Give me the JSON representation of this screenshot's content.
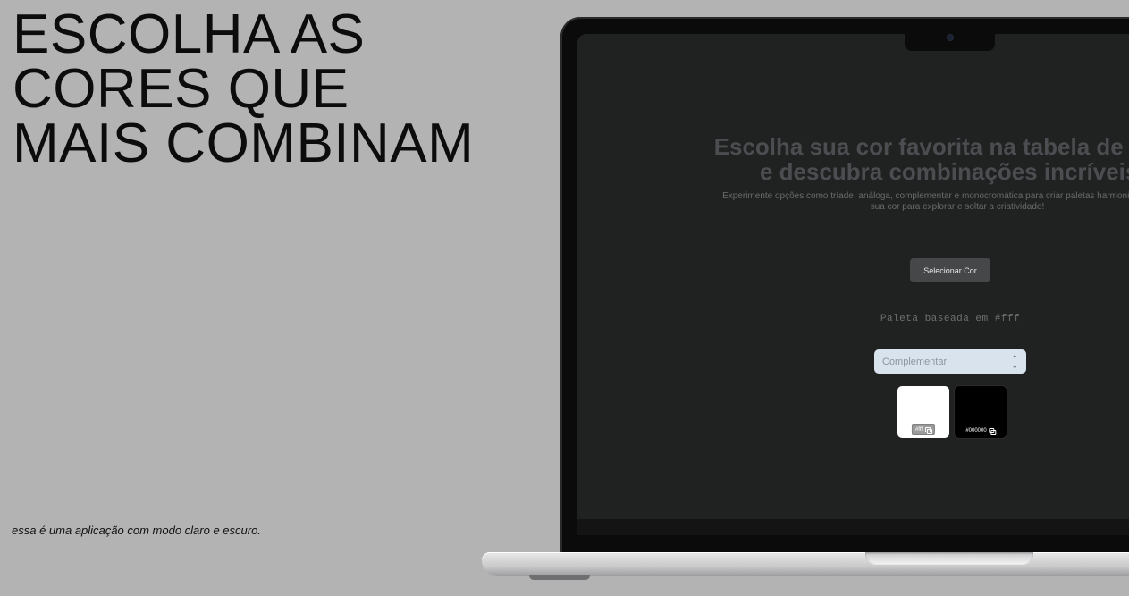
{
  "hero": {
    "headline": "ESCOLHA AS\nCORES QUE\nMAIS COMBINAM",
    "caption": "essa é uma aplicação com modo claro e escuro."
  },
  "app": {
    "title": "Escolha sua cor favorita na tabela de cores e descubra combinações incríveis!",
    "description": "Experimente opções como tríade, análoga, complementar e monocromática para criar paletas harmoniosas. Selecione sua cor para explorar e soltar a criatividade!",
    "select_button_label": "Selecionar Cor",
    "palette_label": "Paleta baseada em #fff",
    "harmony_select": {
      "selected": "Complementar",
      "icon": "chevron-updown-icon"
    },
    "swatches": [
      {
        "hex": "#fff",
        "color": "#ffffff",
        "icon": "copy-icon"
      },
      {
        "hex": "#000000",
        "color": "#000000",
        "icon": "copy-icon"
      }
    ]
  },
  "colors": {
    "background": "#b3b3b3",
    "screen": "#202121",
    "title": "#4b4d50",
    "button": "#464748",
    "select": "#d9e3ee"
  }
}
